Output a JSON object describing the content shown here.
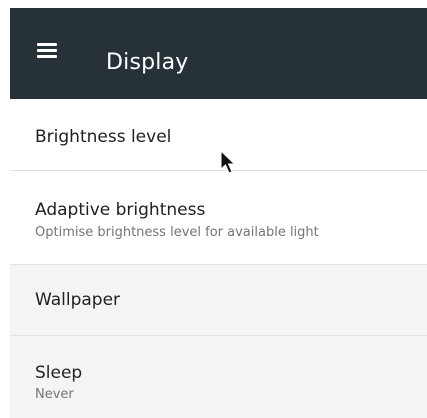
{
  "app_bar": {
    "title": "Display",
    "background": "#263238",
    "menu_icon": "hamburger-menu-icon"
  },
  "settings": [
    {
      "title": "Brightness level",
      "subtitle": ""
    },
    {
      "title": "Adaptive brightness",
      "subtitle": "Optimise brightness level for available light"
    },
    {
      "title": "Wallpaper",
      "subtitle": ""
    },
    {
      "title": "Sleep",
      "subtitle": "Never"
    }
  ],
  "cursor_icon": "mouse-pointer-icon"
}
